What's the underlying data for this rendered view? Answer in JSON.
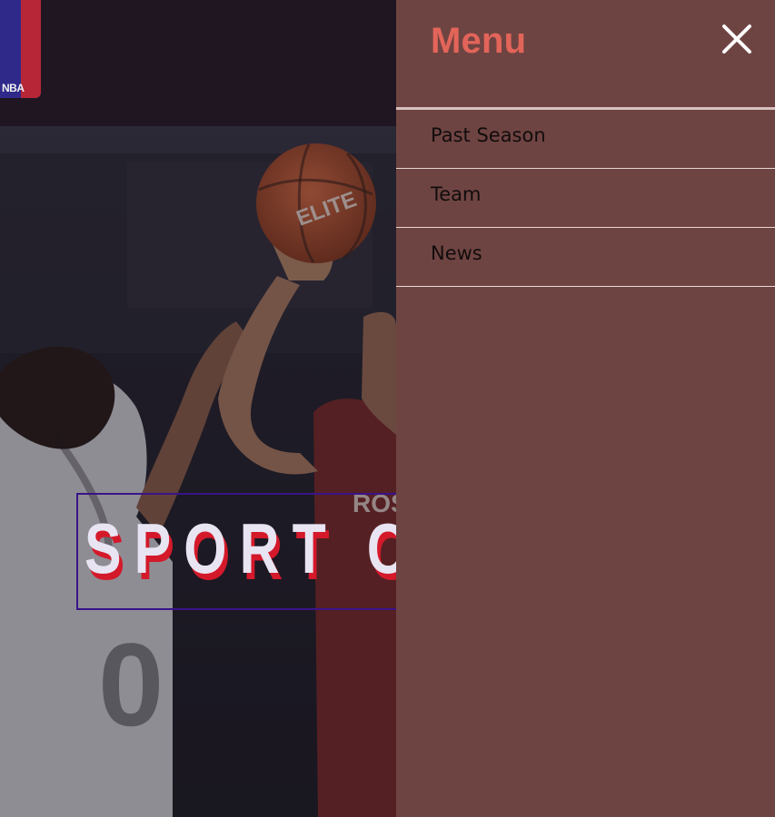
{
  "header": {
    "logo": {
      "text": "NBA",
      "colors": {
        "blue": "#2f2a8a",
        "red": "#b72637"
      }
    }
  },
  "hero": {
    "title": "SPORT C",
    "colors": {
      "text": "#e8e4f2",
      "shadow": "#d3192a",
      "frame": "#3a138a"
    }
  },
  "menu": {
    "title": "Menu",
    "close_icon": "close-icon",
    "items": [
      {
        "label": "Past Season"
      },
      {
        "label": "Team"
      },
      {
        "label": "News"
      }
    ],
    "colors": {
      "background": "#6e4442",
      "title": "#e36459",
      "text": "#120c0c",
      "divider": "#e6d7d5"
    }
  }
}
